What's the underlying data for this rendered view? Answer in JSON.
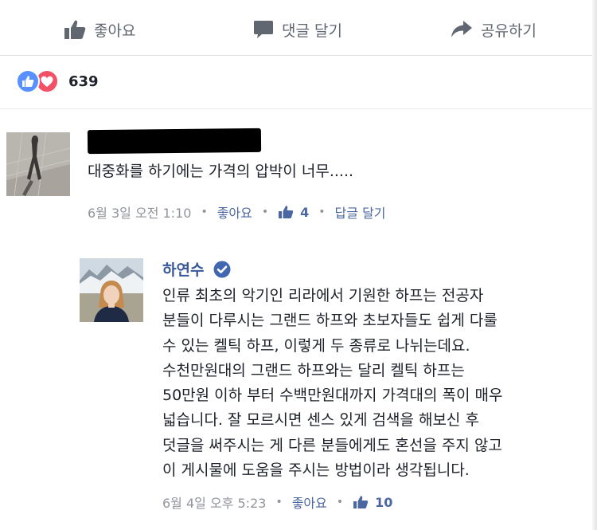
{
  "action_bar": {
    "like_label": "좋아요",
    "comment_label": "댓글 달기",
    "share_label": "공유하기"
  },
  "reactions": {
    "count": "639"
  },
  "comments": [
    {
      "author": "",
      "text": "대중화를 하기에는 가격의 압박이 너무.....",
      "timestamp": "6월 3일 오전 1:10",
      "like_action": "좋아요",
      "like_count": "4",
      "reply_action": "답글 달기"
    },
    {
      "author": "하연수",
      "verified": true,
      "text_lines": [
        "인류 최초의 악기인 리라에서 기원한 하프는 전공자",
        "분들이 다루시는 그랜드 하프와 초보자들도 쉽게 다룰",
        "수 있는 켈틱 하프, 이렇게 두 종류로 나뉘는데요.",
        "수천만원대의 그랜드 하프와는 달리 켈틱 하프는",
        "50만원 이하 부터 수백만원대까지 가격대의 폭이 매우",
        "넓습니다. 잘 모르시면 센스 있게 검색을 해보신 후",
        "덧글을 써주시는 게 다른 분들에게도 혼선을 주지 않고",
        "이 게시물에 도움을 주시는 방법이라 생각됩니다."
      ],
      "timestamp": "6월 4일 오후 5:23",
      "like_action": "좋아요",
      "like_count": "10"
    }
  ],
  "colors": {
    "link": "#4b67a1",
    "meta_gray": "#90949c",
    "like_blue": "#5890ff",
    "love_red": "#f25268",
    "verified_blue": "#4267b2"
  }
}
